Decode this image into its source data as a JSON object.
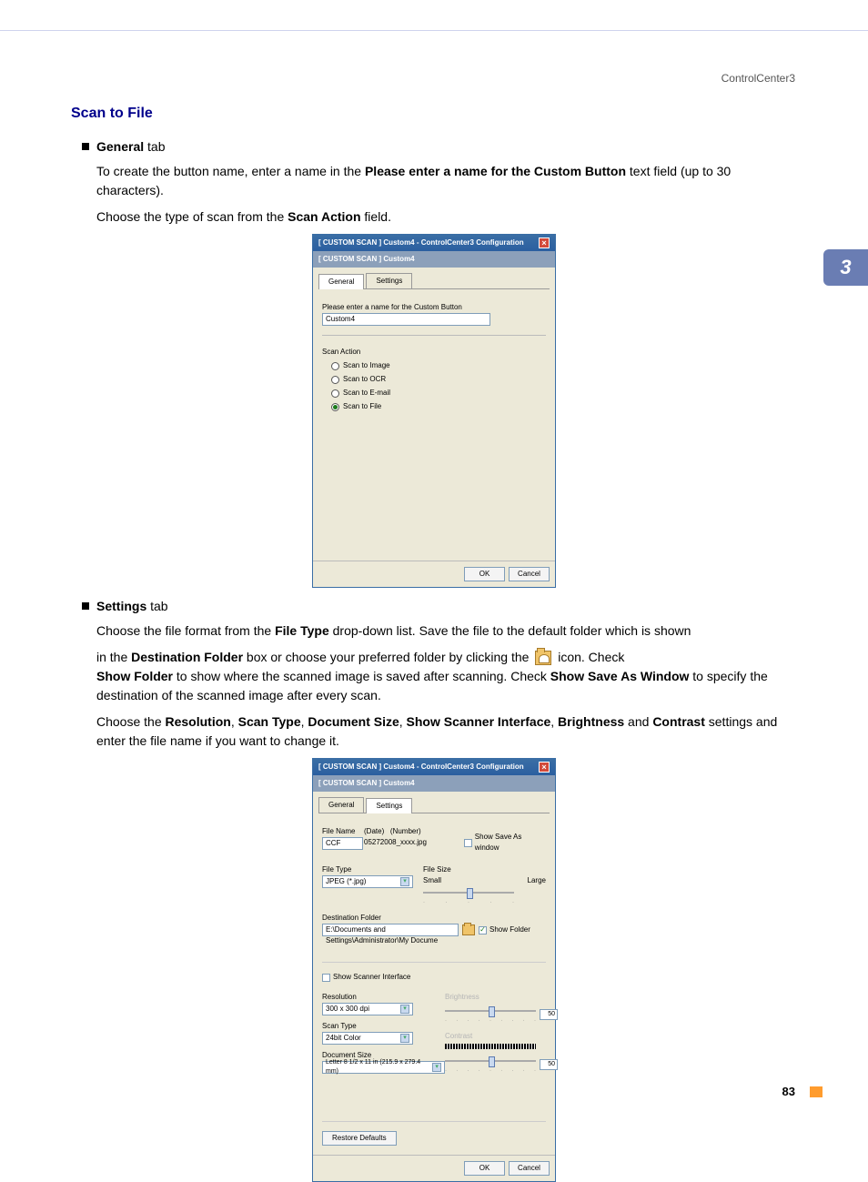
{
  "header": "ControlCenter3",
  "sidetab": "3",
  "title": "Scan to File",
  "bullets": {
    "general": {
      "bold": "General",
      "rest": " tab"
    },
    "settings": {
      "bold": "Settings",
      "rest": " tab"
    }
  },
  "para1a": "To create the button name, enter a name in the ",
  "para1b": "Please enter a name for the Custom Button",
  "para1c": " text field (up to 30 characters).",
  "para2a": "Choose the type of scan from the ",
  "para2b": "Scan Action",
  "para2c": " field.",
  "para3a": "Choose the file format from the ",
  "para3b": "File Type",
  "para3c": " drop-down list. Save the file to the default folder which is shown",
  "para4a": "in the ",
  "para4b": "Destination Folder",
  "para4c": " box or choose your preferred folder by clicking the ",
  "para4d": " icon. Check",
  "para5a": "Show Folder",
  "para5b": " to show where the scanned image is saved after scanning. Check ",
  "para5c": "Show Save As Window",
  "para5d": " to specify the destination of the scanned image after every scan.",
  "para6a": "Choose the ",
  "para6b": "Resolution",
  "para6c": ", ",
  "para6d": "Scan Type",
  "para6e": ", ",
  "para6f": "Document Size",
  "para6g": ", ",
  "para6h": "Show Scanner Interface",
  "para6i": ", ",
  "para6j": "Brightness",
  "para6k": " and ",
  "para6l": "Contrast",
  "para6m": " settings and enter the file name if you want to change it.",
  "dlg1": {
    "title": "[  CUSTOM SCAN  ]   Custom4 - ControlCenter3 Configuration",
    "sub": "[  CUSTOM SCAN  ]   Custom4",
    "tabs": {
      "general": "General",
      "settings": "Settings"
    },
    "prompt": "Please enter a name for the Custom Button",
    "value": "Custom4",
    "sa_label": "Scan Action",
    "r1": "Scan to Image",
    "r2": "Scan to OCR",
    "r3": "Scan to E-mail",
    "r4": "Scan to File",
    "ok": "OK",
    "cancel": "Cancel"
  },
  "dlg2": {
    "title": "[  CUSTOM SCAN  ]   Custom4 - ControlCenter3 Configuration",
    "sub": "[  CUSTOM SCAN  ]   Custom4",
    "tabs": {
      "general": "General",
      "settings": "Settings"
    },
    "filename_lbl": "File Name",
    "filename_val": "CCF",
    "date_lbl": "(Date)",
    "number_lbl": "(Number)",
    "date_val": "05272008_xxxx.jpg",
    "show_saveas": "Show Save As window",
    "filetype_lbl": "File Type",
    "filetype_val": "JPEG (*.jpg)",
    "filesize_lbl": "File Size",
    "small": "Small",
    "large": "Large",
    "dest_lbl": "Destination Folder",
    "dest_val": "E:\\Documents and Settings\\Administrator\\My Docume",
    "show_folder": "Show Folder",
    "ssi": "Show Scanner Interface",
    "res_lbl": "Resolution",
    "res_val": "300 x 300 dpi",
    "st_lbl": "Scan Type",
    "st_val": "24bit Color",
    "ds_lbl": "Document Size",
    "ds_val": "Letter 8 1/2 x 11 in (215.9 x 279.4 mm)",
    "bright_lbl": "Brightness",
    "bright_val": "50",
    "contrast_lbl": "Contrast",
    "contrast_val": "50",
    "restore": "Restore Defaults",
    "ok": "OK",
    "cancel": "Cancel"
  },
  "pagenum": "83"
}
